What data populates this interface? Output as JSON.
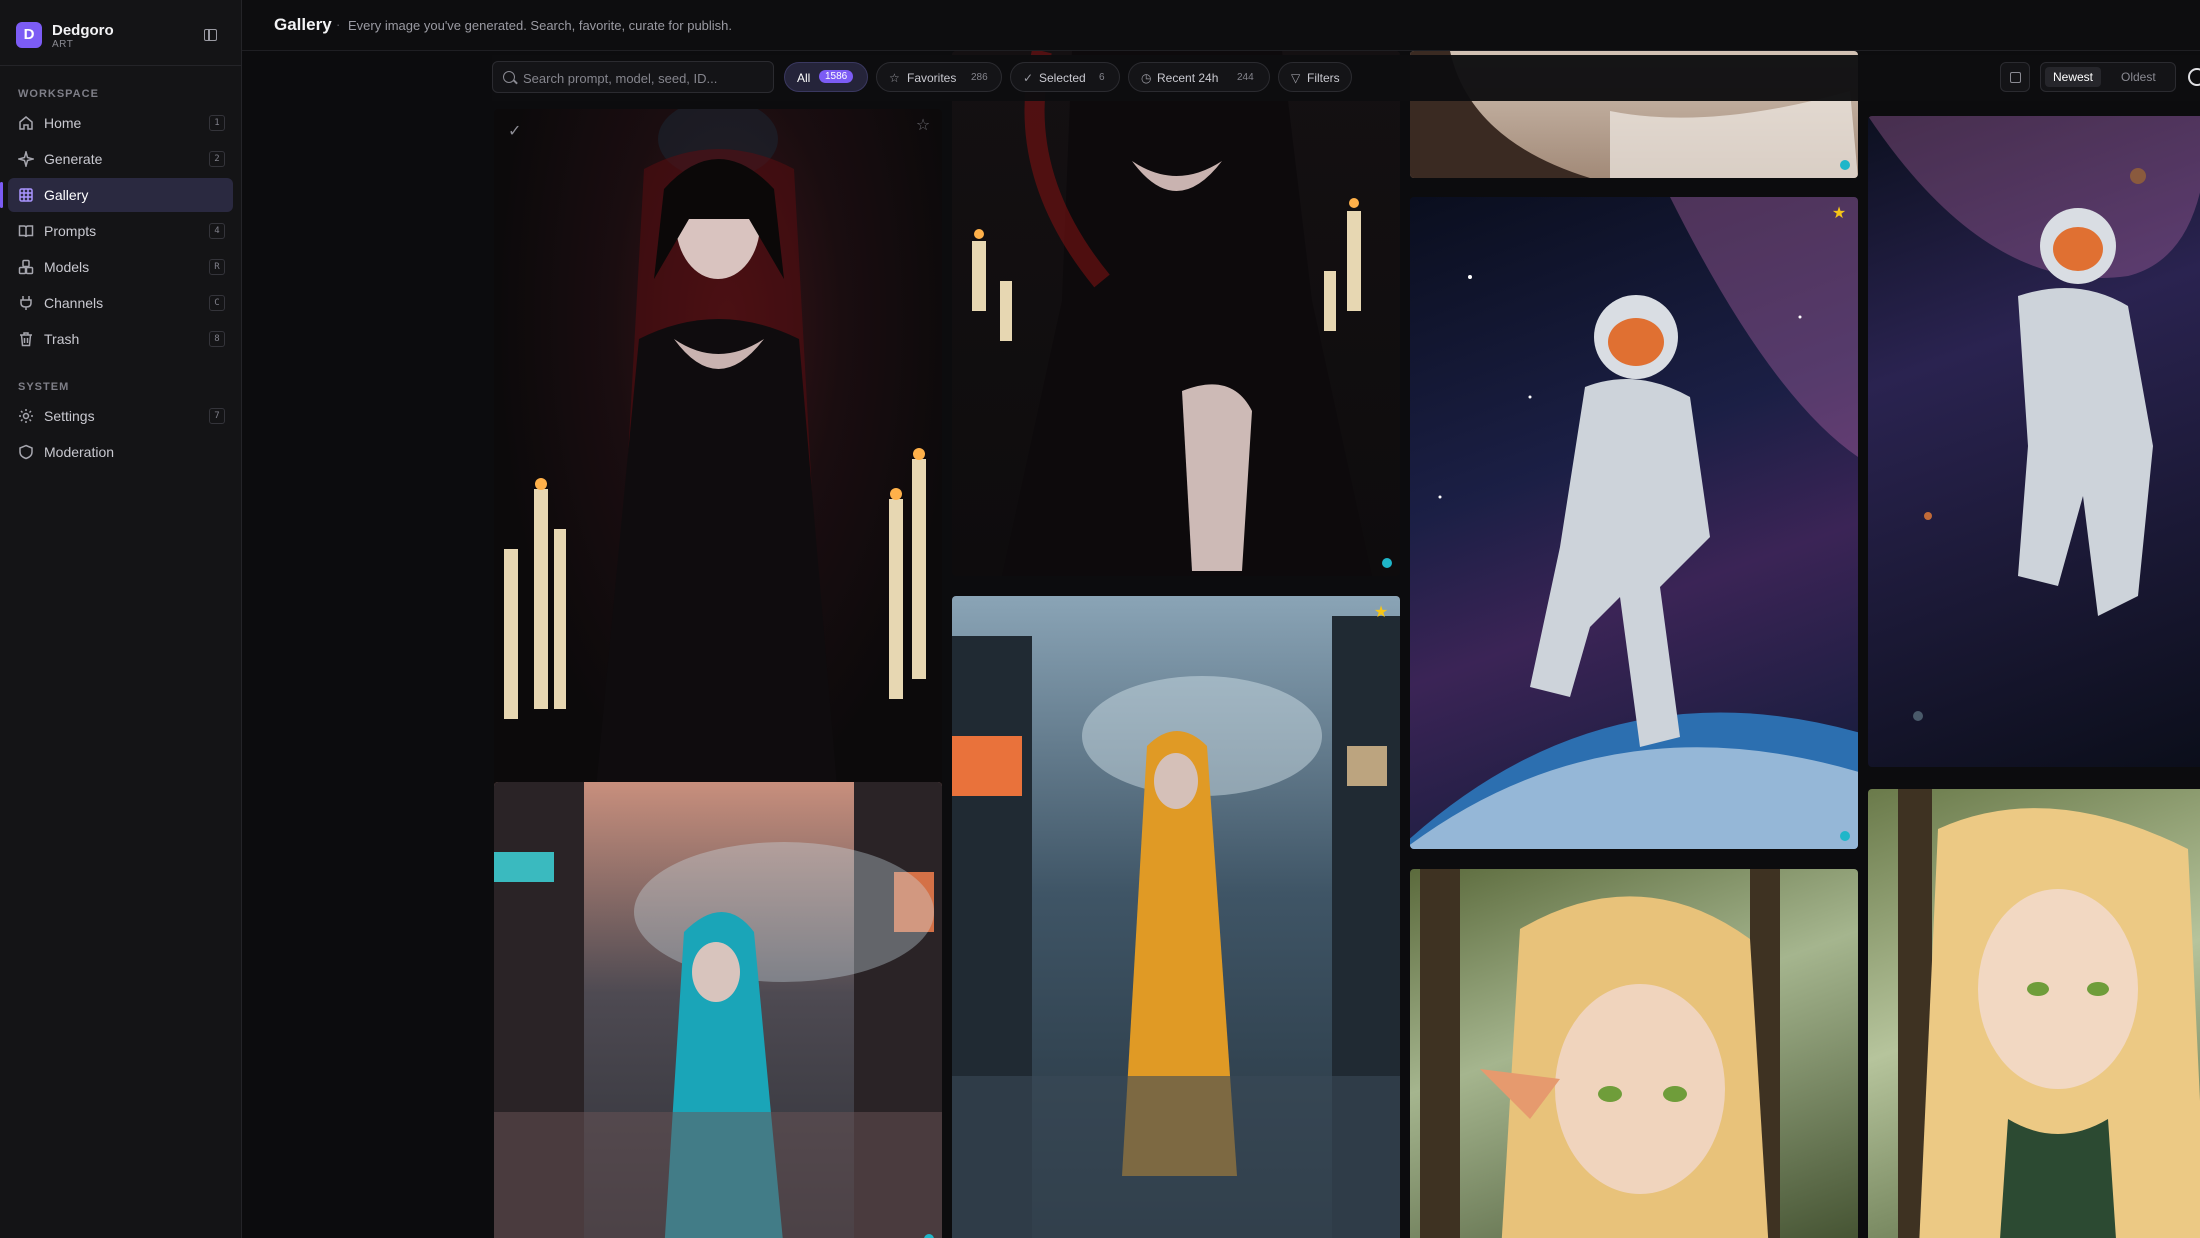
{
  "app": {
    "brand_name": "Dedgoro",
    "brand_sub": "ART",
    "brand_initial": "D"
  },
  "sidebar": {
    "workspace_label": "WORKSPACE",
    "system_label": "SYSTEM",
    "workspace_items": [
      {
        "label": "Home",
        "kbd": "1",
        "icon": "home-icon"
      },
      {
        "label": "Generate",
        "kbd": "2",
        "icon": "sparkles-icon"
      },
      {
        "label": "Gallery",
        "kbd": "",
        "icon": "grid-icon",
        "active": true
      },
      {
        "label": "Prompts",
        "kbd": "4",
        "icon": "book-icon"
      },
      {
        "label": "Models",
        "kbd": "R",
        "icon": "cubes-icon"
      },
      {
        "label": "Channels",
        "kbd": "C",
        "icon": "plug-icon"
      },
      {
        "label": "Trash",
        "kbd": "8",
        "icon": "trash-icon"
      }
    ],
    "system_items": [
      {
        "label": "Settings",
        "kbd": "7",
        "icon": "gear-icon"
      },
      {
        "label": "Moderation",
        "kbd": "",
        "icon": "shield-icon"
      }
    ]
  },
  "header": {
    "title": "Gallery",
    "separator": "·",
    "subtitle": "Every image you've generated. Search, favorite, curate for publish."
  },
  "toolbar": {
    "search_placeholder": "Search prompt, model, seed, ID...",
    "chips": [
      {
        "label": "All",
        "count": "1586",
        "active": true
      },
      {
        "label": "Favorites",
        "count": "286",
        "icon": "star-icon"
      },
      {
        "label": "Selected",
        "count": "6",
        "icon": "check-icon"
      },
      {
        "label": "Recent 24h",
        "count": "244",
        "icon": "clock-icon"
      },
      {
        "label": "Filters",
        "count": "",
        "icon": "filter-icon"
      }
    ],
    "sort_newest": "Newest",
    "sort_oldest": "Oldest"
  },
  "gallery": {
    "cards": [
      {
        "subject": "gothic-lady-candles",
        "favorite": false,
        "selected": true
      },
      {
        "subject": "gothic-dress-candles",
        "favorite": false
      },
      {
        "subject": "cropped-top",
        "favorite": false
      },
      {
        "subject": "astronaut-nebula",
        "favorite": true
      },
      {
        "subject": "astronaut-stars",
        "favorite": false
      },
      {
        "subject": "girl-yellow-raincoat",
        "favorite": true
      },
      {
        "subject": "girl-blue-raincoat",
        "favorite": false
      },
      {
        "subject": "elf-forest",
        "favorite": false
      },
      {
        "subject": "elf-portrait",
        "favorite": false
      }
    ]
  },
  "colors": {
    "accent": "#7c5cf5",
    "status_dot": "#1fb6c9",
    "favorite_star": "#f5c518",
    "background": "#0c0c0e"
  }
}
